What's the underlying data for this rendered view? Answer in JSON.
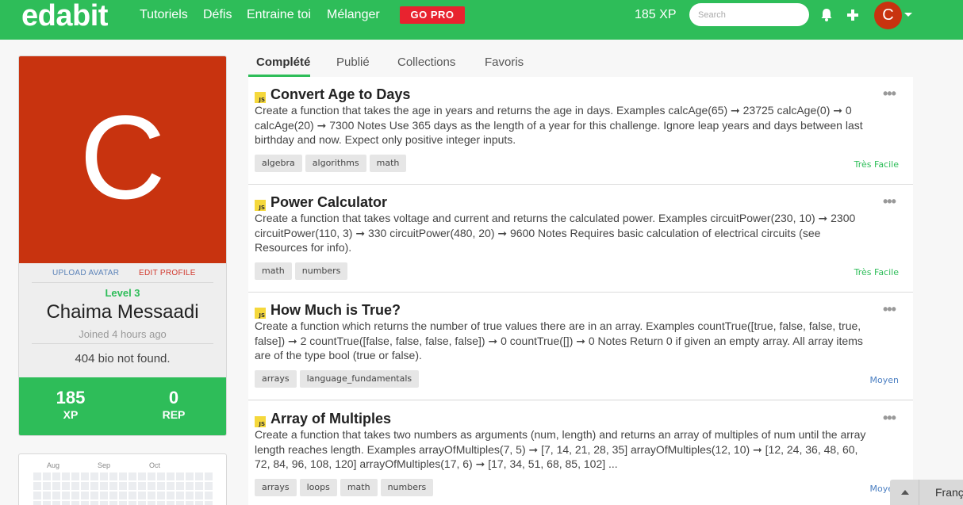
{
  "navbar": {
    "brand": "edabit",
    "links": [
      "Tutoriels",
      "Défis",
      "Entraine toi",
      "Mélanger"
    ],
    "go_pro": "GO PRO",
    "xp": "185 XP",
    "search_placeholder": "Search",
    "avatar_initial": "C",
    "colors": {
      "background": "#2ebd59",
      "go_pro": "#e8232f",
      "avatar": "#c8330f"
    }
  },
  "profile": {
    "avatar_initial": "C",
    "upload_avatar": "UPLOAD AVATAR",
    "edit_profile": "EDIT PROFILE",
    "level": "Level 3",
    "name": "Chaima Messaadi",
    "joined": "Joined 4 hours ago",
    "bio": "404 bio not found.",
    "stats": [
      {
        "value": "185",
        "label": "XP"
      },
      {
        "value": "0",
        "label": "REP"
      }
    ]
  },
  "calendar": {
    "months": [
      "Aug",
      "Sep",
      "Oct"
    ]
  },
  "tabs": [
    "Complété",
    "Publié",
    "Collections",
    "Favoris"
  ],
  "active_tab": "Complété",
  "challenges": [
    {
      "language": "JS",
      "title": "Convert Age to Days",
      "description": "Create a function that takes the age in years and returns the age in days. Examples calcAge(65) ➞ 23725 calcAge(0) ➞ 0 calcAge(20) ➞ 7300 Notes Use 365 days as the length of a year for this challenge. Ignore leap years and days between last birthday and now. Expect only positive integer inputs.",
      "tags": [
        "algebra",
        "algorithms",
        "math"
      ],
      "difficulty": "Très Facile"
    },
    {
      "language": "JS",
      "title": "Power Calculator",
      "description": "Create a function that takes voltage and current and returns the calculated power. Examples circuitPower(230, 10) ➞ 2300 circuitPower(110, 3) ➞ 330 circuitPower(480, 20) ➞ 9600 Notes Requires basic calculation of electrical circuits (see Resources for info).",
      "tags": [
        "math",
        "numbers"
      ],
      "difficulty": "Très Facile"
    },
    {
      "language": "JS",
      "title": "How Much is True?",
      "description": "Create a function which returns the number of true values there are in an array. Examples countTrue([true, false, false, true, false]) ➞ 2 countTrue([false, false, false, false]) ➞ 0 countTrue([]) ➞ 0 Notes Return 0 if given an empty array. All array items are of the type bool (true or false).",
      "tags": [
        "arrays",
        "language_fundamentals"
      ],
      "difficulty": "Moyen"
    },
    {
      "language": "JS",
      "title": "Array of Multiples",
      "description": "Create a function that takes two numbers as arguments (num, length) and returns an array of multiples of num until the array length reaches length. Examples arrayOfMultiples(7, 5) ➞ [7, 14, 21, 28, 35] arrayOfMultiples(12, 10) ➞ [12, 24, 36, 48, 60, 72, 84, 96, 108, 120] arrayOfMultiples(17, 6) ➞ [17, 34, 51, 68, 85, 102] ...",
      "tags": [
        "arrays",
        "loops",
        "math",
        "numbers"
      ],
      "difficulty": "Moyen"
    }
  ],
  "more_icon": "•••",
  "language_bar": {
    "label": "Français"
  }
}
